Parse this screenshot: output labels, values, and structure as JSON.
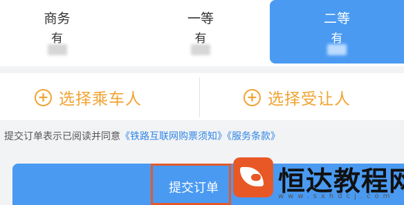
{
  "seats": [
    {
      "name": "商务",
      "availability": "有"
    },
    {
      "name": "一等",
      "availability": "有"
    },
    {
      "name": "二等",
      "availability": "有",
      "selected": true
    }
  ],
  "actions": {
    "add_passenger": "选择乘车人",
    "add_transferee": "选择受让人"
  },
  "agreement": {
    "text": "提交订单表示已阅读并同意",
    "link1": "《铁路互联网购票须知》",
    "link2": "《服务条款》"
  },
  "submit_label": "提交订单",
  "watermark": {
    "title": "恒达教程网",
    "url": "www.sxhdcj.com"
  },
  "colors": {
    "accent_blue": "#4a9af2",
    "action_orange": "#f0a331",
    "link_blue": "#2f86e6",
    "highlight_red": "#e25a2c"
  }
}
